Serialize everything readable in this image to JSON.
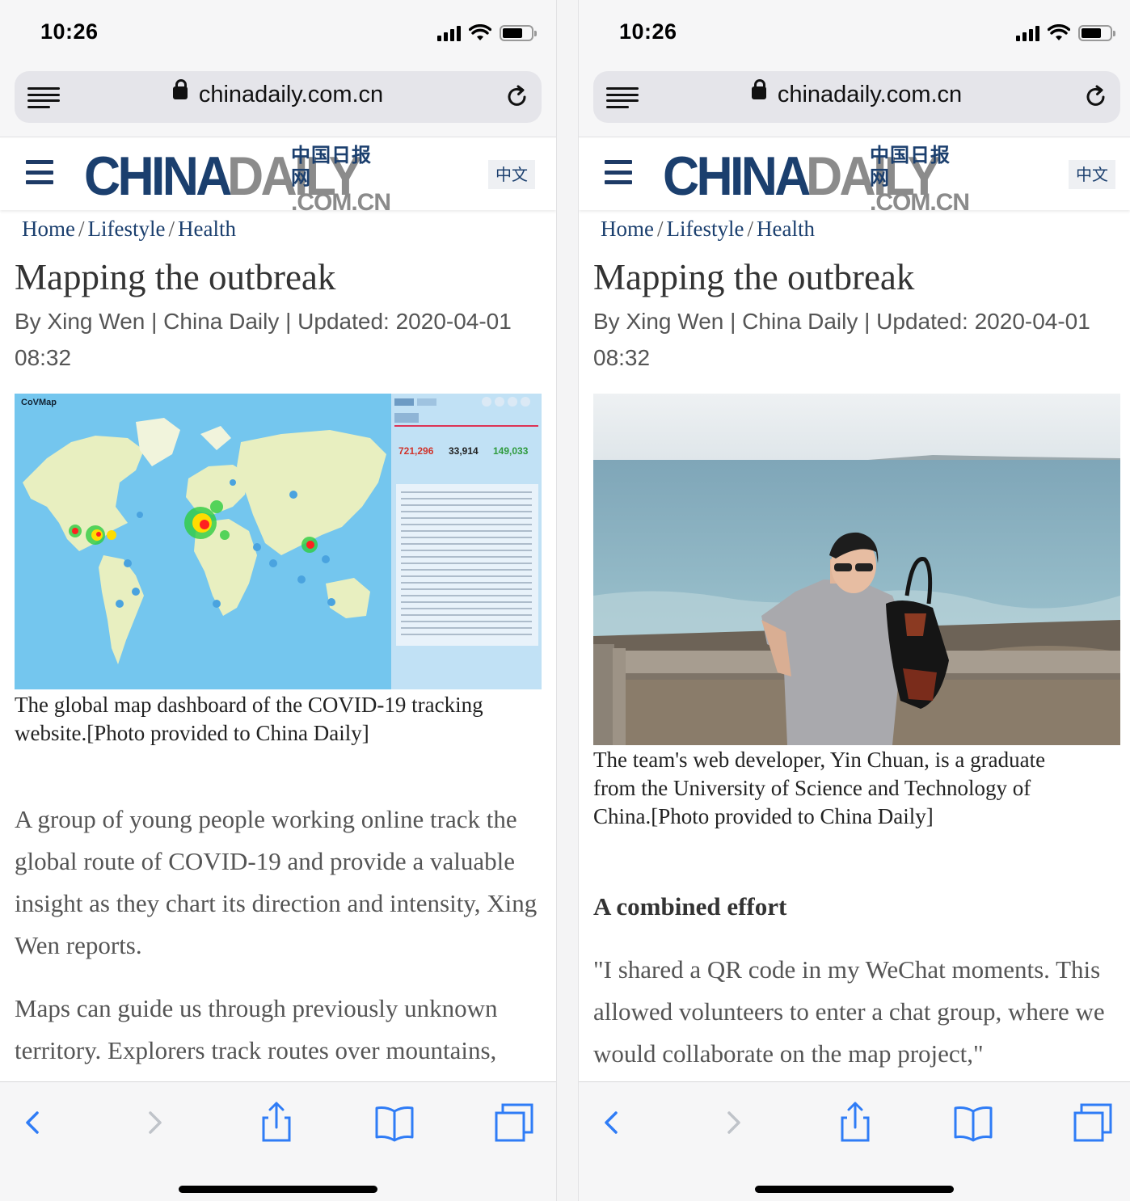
{
  "status_bar": {
    "time": "10:26"
  },
  "browser": {
    "url": "chinadaily.com.cn"
  },
  "site": {
    "logo_china": "CHINA",
    "logo_daily": "DAILY",
    "logo_cn_chars": "中国日报网",
    "logo_comcn": ".COM.CN",
    "lang_button": "中文"
  },
  "breadcrumb": [
    {
      "label": "Home"
    },
    {
      "label": "Lifestyle"
    },
    {
      "label": "Health"
    }
  ],
  "article": {
    "title": "Mapping the outbreak",
    "byline_line1": "By Xing Wen | China Daily | Updated: 2020-04-01",
    "byline_line2": "08:32"
  },
  "left_screen": {
    "image": {
      "site_name": "CoVMap",
      "stats": [
        "721,296",
        "33,914",
        "149,033"
      ]
    },
    "caption_line1": "The global map dashboard of the COVID-19 tracking",
    "caption_line2": "website.[Photo provided to China Daily]",
    "paragraphs": [
      "A group of young people working online track the global route of COVID-19 and provide a valuable insight as they chart its direction and intensity, Xing Wen reports.",
      "Maps can guide us through previously unknown territory. Explorers track routes over mountains,"
    ]
  },
  "right_screen": {
    "caption_line1": "The team's web developer, Yin Chuan, is a graduate",
    "caption_line2": "from the University of Science and Technology of",
    "caption_line3": "China.[Photo provided to China Daily]",
    "subheading": "A combined effort",
    "paragraph": "\"I shared a QR code in my WeChat moments. This allowed volunteers to enter a chat group, where we would collaborate on the map project,\""
  },
  "toolbar_icons": [
    "back-icon",
    "forward-icon",
    "share-icon",
    "bookmarks-icon",
    "tabs-icon"
  ],
  "colors": {
    "brand_blue": "#1b3f6e",
    "link_blue": "#1b3f6e",
    "toolbar_blue": "#2f7cf6",
    "map_ocean": "#74c6ee",
    "map_land": "#e8efc0"
  }
}
